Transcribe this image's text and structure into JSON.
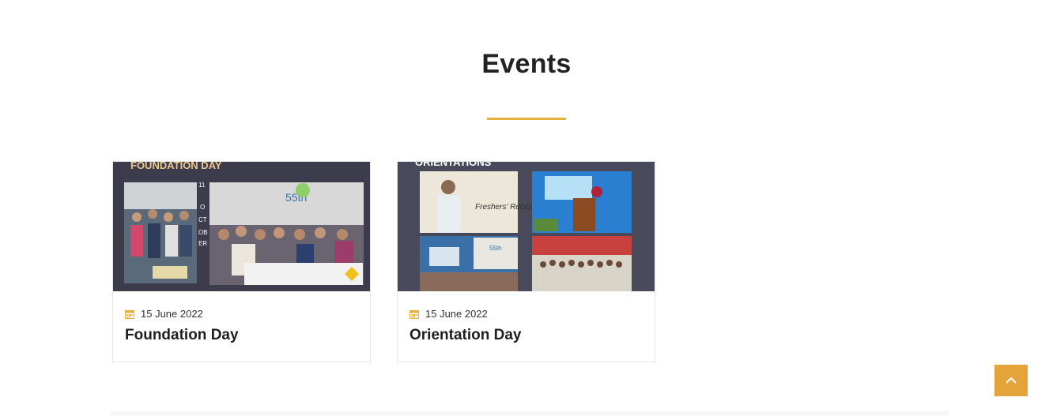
{
  "section": {
    "title": "Events"
  },
  "events": [
    {
      "banner": "FOUNDATION DAY",
      "date": "15 June 2022",
      "title": "Foundation Day",
      "poster_text": {
        "anniversary": "55th",
        "side": [
          "11",
          "O",
          "CT",
          "OB",
          "ER"
        ]
      }
    },
    {
      "banner": "ORIENTATIONS",
      "date": "15 June 2022",
      "title": "Orientation Day",
      "poster_text": {
        "panel": "Freshers' Reception",
        "anniversary": "55th"
      }
    }
  ],
  "icons": {
    "date": "calendar-icon",
    "scroll_top": "chevron-up-icon"
  },
  "colors": {
    "accent": "#e5b13f",
    "scroll_button": "#e5a43a"
  }
}
